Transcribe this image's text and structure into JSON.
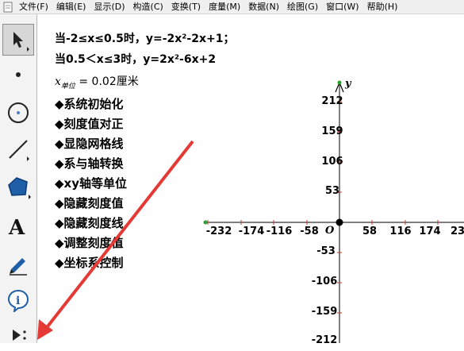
{
  "menu": {
    "items": [
      "文件(F)",
      "编辑(E)",
      "显示(D)",
      "构造(C)",
      "变换(T)",
      "度量(M)",
      "数据(N)",
      "绘图(G)",
      "窗口(W)",
      "帮助(H)"
    ]
  },
  "toolbar": {
    "tools": [
      "arrow-select-tool",
      "point-tool",
      "compass-tool",
      "straightedge-tool",
      "polygon-tool",
      "text-tool",
      "marker-tool",
      "information-tool",
      "custom-tools"
    ]
  },
  "canvas": {
    "functions": [
      "当-2≤x≤0.5时，y=-2x²-2x+1；",
      "当0.5＜x≤3时，y=2x²-6x+2"
    ],
    "unit_measure": {
      "symbol": "x",
      "subscript": "单位",
      "value": "= 0.02厘米"
    },
    "action_buttons": [
      "◆系统初始化",
      "◆刻度值对正",
      "◆显隐网格线",
      "◆系与轴转换",
      "◆xy轴等单位",
      "◆隐藏刻度值",
      "◆隐藏刻度线",
      "◆调整刻度值",
      "◆坐标系控制"
    ],
    "axes": {
      "origin_label": "O",
      "y_label": "y",
      "x_ticks": [
        "-232",
        "-174",
        "-116",
        "-58",
        "58",
        "116",
        "174",
        "232"
      ],
      "y_ticks": [
        "212",
        "159",
        "106",
        "53",
        "-53",
        "-106",
        "-159",
        "-212"
      ]
    }
  },
  "colors": {
    "arrow": "#e53935",
    "axis": "#000000",
    "tick_mark": "#c0392b",
    "point_green": "#2e9e2e",
    "polygon_tool": "#1f5fa8"
  }
}
